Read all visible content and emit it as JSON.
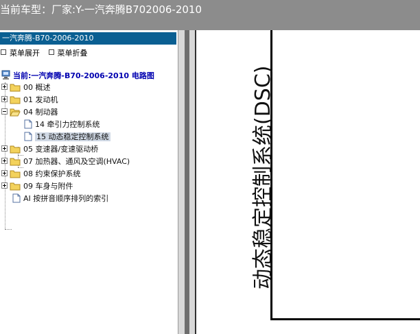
{
  "window": {
    "title": "当前车型：厂家:Y-一汽奔腾B702006-2010"
  },
  "tree": {
    "header": "一汽奔腾-B70-2006-2010",
    "expand_all": "菜单展开",
    "collapse_all": "菜单折叠",
    "root": "当前:一汽奔腾-B70-2006-2010 电路图",
    "nodes": [
      {
        "label": "00 概述"
      },
      {
        "label": "01 发动机"
      },
      {
        "label": "04 制动器"
      },
      {
        "label": "14 牵引力控制系统"
      },
      {
        "label": "15 动态稳定控制系统"
      },
      {
        "label": "05 变速器/变速驱动桥"
      },
      {
        "label": "07 加热器、通风及空调(HVAC)"
      },
      {
        "label": "08 约束保护系统"
      },
      {
        "label": "09 车身与附件"
      },
      {
        "label": "AI 按拼音顺序排列的索引"
      }
    ],
    "selected": "15 动态稳定控制系统"
  },
  "diagram": {
    "title": "动态稳定控制系统(DSC)"
  },
  "icons": [
    "computer-icon",
    "folder-icon",
    "folder-open-icon",
    "document-icon",
    "expand-icon",
    "collapse-icon"
  ],
  "colors": {
    "title_bar": "#8c8c8c",
    "tree_header": "#0a5f92",
    "root_text": "#0000b0",
    "selection": "#cfd8e4"
  }
}
